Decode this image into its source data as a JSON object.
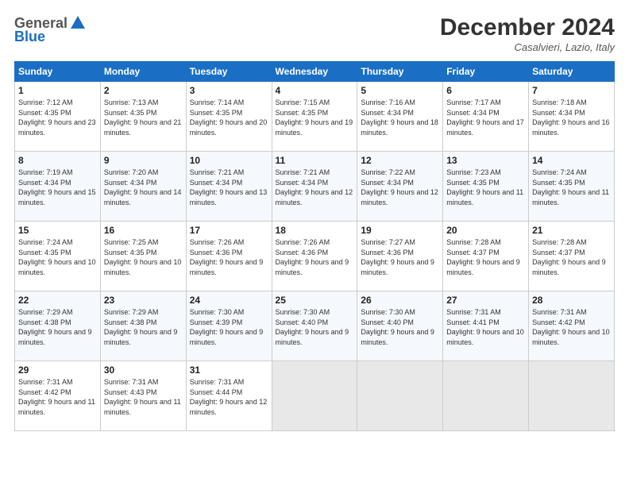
{
  "header": {
    "logo_general": "General",
    "logo_blue": "Blue",
    "month_title": "December 2024",
    "location": "Casalvieri, Lazio, Italy"
  },
  "columns": [
    "Sunday",
    "Monday",
    "Tuesday",
    "Wednesday",
    "Thursday",
    "Friday",
    "Saturday"
  ],
  "weeks": [
    [
      {
        "day": "1",
        "sunrise": "Sunrise: 7:12 AM",
        "sunset": "Sunset: 4:35 PM",
        "daylight": "Daylight: 9 hours and 23 minutes."
      },
      {
        "day": "2",
        "sunrise": "Sunrise: 7:13 AM",
        "sunset": "Sunset: 4:35 PM",
        "daylight": "Daylight: 9 hours and 21 minutes."
      },
      {
        "day": "3",
        "sunrise": "Sunrise: 7:14 AM",
        "sunset": "Sunset: 4:35 PM",
        "daylight": "Daylight: 9 hours and 20 minutes."
      },
      {
        "day": "4",
        "sunrise": "Sunrise: 7:15 AM",
        "sunset": "Sunset: 4:35 PM",
        "daylight": "Daylight: 9 hours and 19 minutes."
      },
      {
        "day": "5",
        "sunrise": "Sunrise: 7:16 AM",
        "sunset": "Sunset: 4:34 PM",
        "daylight": "Daylight: 9 hours and 18 minutes."
      },
      {
        "day": "6",
        "sunrise": "Sunrise: 7:17 AM",
        "sunset": "Sunset: 4:34 PM",
        "daylight": "Daylight: 9 hours and 17 minutes."
      },
      {
        "day": "7",
        "sunrise": "Sunrise: 7:18 AM",
        "sunset": "Sunset: 4:34 PM",
        "daylight": "Daylight: 9 hours and 16 minutes."
      }
    ],
    [
      {
        "day": "8",
        "sunrise": "Sunrise: 7:19 AM",
        "sunset": "Sunset: 4:34 PM",
        "daylight": "Daylight: 9 hours and 15 minutes."
      },
      {
        "day": "9",
        "sunrise": "Sunrise: 7:20 AM",
        "sunset": "Sunset: 4:34 PM",
        "daylight": "Daylight: 9 hours and 14 minutes."
      },
      {
        "day": "10",
        "sunrise": "Sunrise: 7:21 AM",
        "sunset": "Sunset: 4:34 PM",
        "daylight": "Daylight: 9 hours and 13 minutes."
      },
      {
        "day": "11",
        "sunrise": "Sunrise: 7:21 AM",
        "sunset": "Sunset: 4:34 PM",
        "daylight": "Daylight: 9 hours and 12 minutes."
      },
      {
        "day": "12",
        "sunrise": "Sunrise: 7:22 AM",
        "sunset": "Sunset: 4:34 PM",
        "daylight": "Daylight: 9 hours and 12 minutes."
      },
      {
        "day": "13",
        "sunrise": "Sunrise: 7:23 AM",
        "sunset": "Sunset: 4:35 PM",
        "daylight": "Daylight: 9 hours and 11 minutes."
      },
      {
        "day": "14",
        "sunrise": "Sunrise: 7:24 AM",
        "sunset": "Sunset: 4:35 PM",
        "daylight": "Daylight: 9 hours and 11 minutes."
      }
    ],
    [
      {
        "day": "15",
        "sunrise": "Sunrise: 7:24 AM",
        "sunset": "Sunset: 4:35 PM",
        "daylight": "Daylight: 9 hours and 10 minutes."
      },
      {
        "day": "16",
        "sunrise": "Sunrise: 7:25 AM",
        "sunset": "Sunset: 4:35 PM",
        "daylight": "Daylight: 9 hours and 10 minutes."
      },
      {
        "day": "17",
        "sunrise": "Sunrise: 7:26 AM",
        "sunset": "Sunset: 4:36 PM",
        "daylight": "Daylight: 9 hours and 9 minutes."
      },
      {
        "day": "18",
        "sunrise": "Sunrise: 7:26 AM",
        "sunset": "Sunset: 4:36 PM",
        "daylight": "Daylight: 9 hours and 9 minutes."
      },
      {
        "day": "19",
        "sunrise": "Sunrise: 7:27 AM",
        "sunset": "Sunset: 4:36 PM",
        "daylight": "Daylight: 9 hours and 9 minutes."
      },
      {
        "day": "20",
        "sunrise": "Sunrise: 7:28 AM",
        "sunset": "Sunset: 4:37 PM",
        "daylight": "Daylight: 9 hours and 9 minutes."
      },
      {
        "day": "21",
        "sunrise": "Sunrise: 7:28 AM",
        "sunset": "Sunset: 4:37 PM",
        "daylight": "Daylight: 9 hours and 9 minutes."
      }
    ],
    [
      {
        "day": "22",
        "sunrise": "Sunrise: 7:29 AM",
        "sunset": "Sunset: 4:38 PM",
        "daylight": "Daylight: 9 hours and 9 minutes."
      },
      {
        "day": "23",
        "sunrise": "Sunrise: 7:29 AM",
        "sunset": "Sunset: 4:38 PM",
        "daylight": "Daylight: 9 hours and 9 minutes."
      },
      {
        "day": "24",
        "sunrise": "Sunrise: 7:30 AM",
        "sunset": "Sunset: 4:39 PM",
        "daylight": "Daylight: 9 hours and 9 minutes."
      },
      {
        "day": "25",
        "sunrise": "Sunrise: 7:30 AM",
        "sunset": "Sunset: 4:40 PM",
        "daylight": "Daylight: 9 hours and 9 minutes."
      },
      {
        "day": "26",
        "sunrise": "Sunrise: 7:30 AM",
        "sunset": "Sunset: 4:40 PM",
        "daylight": "Daylight: 9 hours and 9 minutes."
      },
      {
        "day": "27",
        "sunrise": "Sunrise: 7:31 AM",
        "sunset": "Sunset: 4:41 PM",
        "daylight": "Daylight: 9 hours and 10 minutes."
      },
      {
        "day": "28",
        "sunrise": "Sunrise: 7:31 AM",
        "sunset": "Sunset: 4:42 PM",
        "daylight": "Daylight: 9 hours and 10 minutes."
      }
    ],
    [
      {
        "day": "29",
        "sunrise": "Sunrise: 7:31 AM",
        "sunset": "Sunset: 4:42 PM",
        "daylight": "Daylight: 9 hours and 11 minutes."
      },
      {
        "day": "30",
        "sunrise": "Sunrise: 7:31 AM",
        "sunset": "Sunset: 4:43 PM",
        "daylight": "Daylight: 9 hours and 11 minutes."
      },
      {
        "day": "31",
        "sunrise": "Sunrise: 7:31 AM",
        "sunset": "Sunset: 4:44 PM",
        "daylight": "Daylight: 9 hours and 12 minutes."
      },
      null,
      null,
      null,
      null
    ]
  ]
}
